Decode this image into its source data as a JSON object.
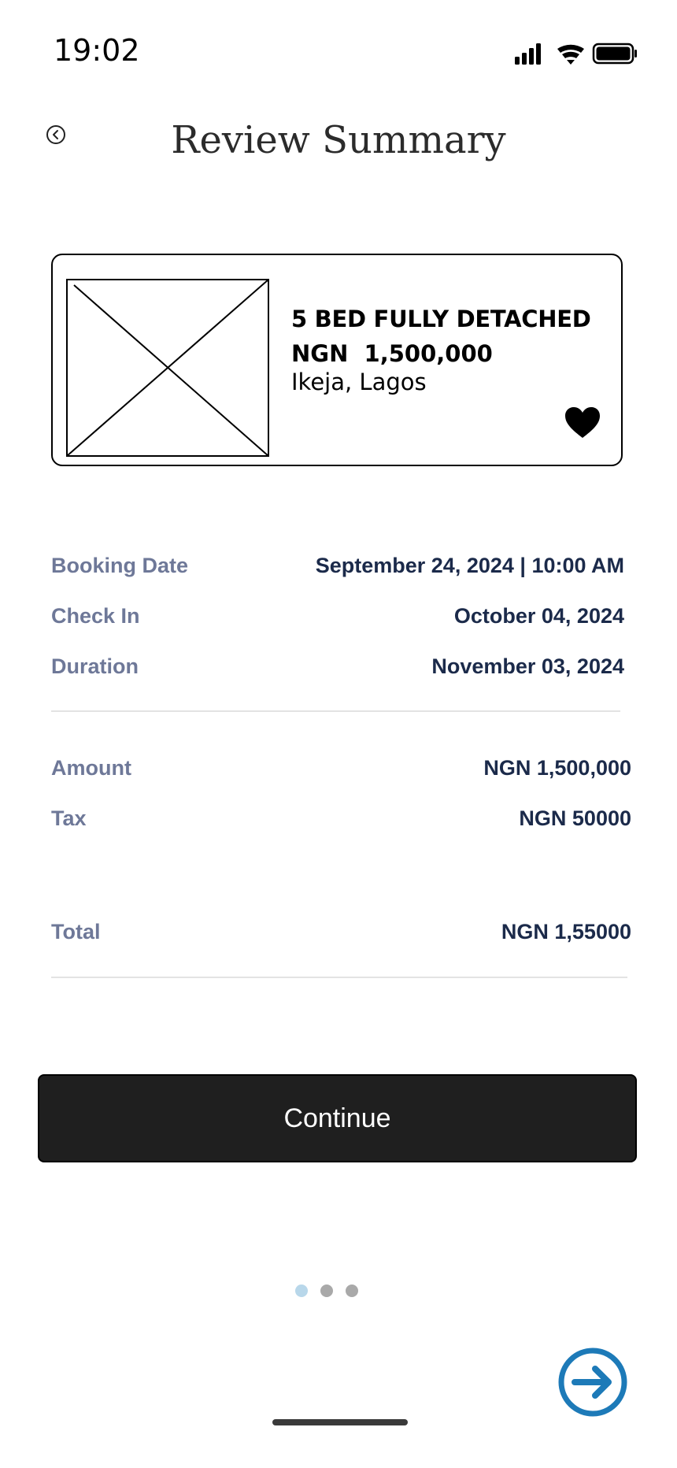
{
  "status_bar": {
    "time": "19:02"
  },
  "header": {
    "title": "Review Summary"
  },
  "property": {
    "title": "5 BED FULLY DETACHED",
    "price": "NGN  1,500,000",
    "location": "Ikeja, Lagos"
  },
  "booking": {
    "date_label": "Booking Date",
    "date_value": "September 24, 2024 | 10:00 AM",
    "checkin_label": "Check In",
    "checkin_value": "October 04, 2024",
    "duration_label": "Duration",
    "duration_value": "November 03, 2024"
  },
  "payment": {
    "amount_label": "Amount",
    "amount_value": "NGN 1,500,000",
    "tax_label": "Tax",
    "tax_value": "NGN 50000",
    "total_label": "Total",
    "total_value": "NGN 1,55000"
  },
  "actions": {
    "continue_label": "Continue"
  },
  "pagination": {
    "active_index": 0,
    "count": 3
  },
  "colors": {
    "label": "#6e7898",
    "value": "#1b2a4a",
    "button": "#1f1f1f",
    "accent": "#1d7ab8",
    "dot_active": "#b8d7ea",
    "dot_inactive": "#a9a9a9"
  }
}
